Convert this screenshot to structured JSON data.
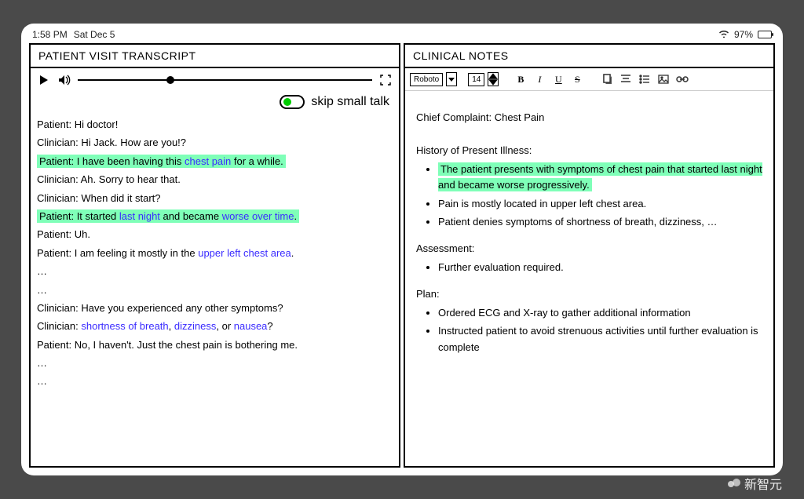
{
  "status": {
    "time": "1:58 PM",
    "date": "Sat Dec 5",
    "battery_pct": "97%"
  },
  "left": {
    "header": "PATIENT VISIT TRANSCRIPT",
    "toggle_label": "skip small talk",
    "lines": [
      {
        "pre": "Patient: Hi doctor!",
        "hl": false
      },
      {
        "pre": "Clinician: Hi Jack. How are you!?",
        "hl": false
      },
      {
        "pre": "Patient: I have been having this ",
        "kw": "chest pain",
        "post": " for a while.",
        "hl": true
      },
      {
        "pre": "Clinician: Ah. Sorry to hear that.",
        "hl": false
      },
      {
        "pre": "Clinician: When did it start?",
        "hl": false
      },
      {
        "pre": "Patient: It started ",
        "kw": "last night",
        "mid": " and became ",
        "kw2": "worse over time",
        "post": ".",
        "hl": true
      },
      {
        "pre": "Patient: Uh.",
        "hl": false
      },
      {
        "pre": "Patient: I am feeling it mostly in the ",
        "kw": "upper left chest area",
        "post": ".",
        "hl": false
      },
      {
        "pre": "…",
        "hl": false
      },
      {
        "pre": "…",
        "hl": false
      },
      {
        "pre": "Clinician: Have you experienced any other symptoms?",
        "hl": false
      },
      {
        "pre": "Clinician: ",
        "kw": "shortness of breath",
        "mid": ", ",
        "kw2": "dizziness",
        "mid2": ", or ",
        "kw3": "nausea",
        "post": "?",
        "hl": false
      },
      {
        "pre": "Patient: No, I haven't. Just the chest pain is bothering me.",
        "hl": false
      },
      {
        "pre": "…",
        "hl": false
      },
      {
        "pre": "…",
        "hl": false
      }
    ]
  },
  "right": {
    "header": "CLINICAL NOTES",
    "font_name": "Roboto",
    "font_size": "14",
    "chief": "Chief Complaint: Chest Pain",
    "hpi_title": "History of Present Illness:",
    "hpi": [
      {
        "text": "The patient presents with symptoms of chest pain that started last night and became worse progressively.",
        "hl": true
      },
      {
        "text": "Pain is mostly located in upper left chest area.",
        "hl": false
      },
      {
        "text": "Patient denies symptoms of shortness of breath, dizziness, …",
        "hl": false
      }
    ],
    "assess_title": "Assessment:",
    "assess": [
      "Further evaluation required."
    ],
    "plan_title": "Plan:",
    "plan": [
      "Ordered ECG and X-ray to gather additional information",
      "Instructed patient to avoid strenuous activities until further evaluation is complete"
    ]
  },
  "watermark": "新智元"
}
